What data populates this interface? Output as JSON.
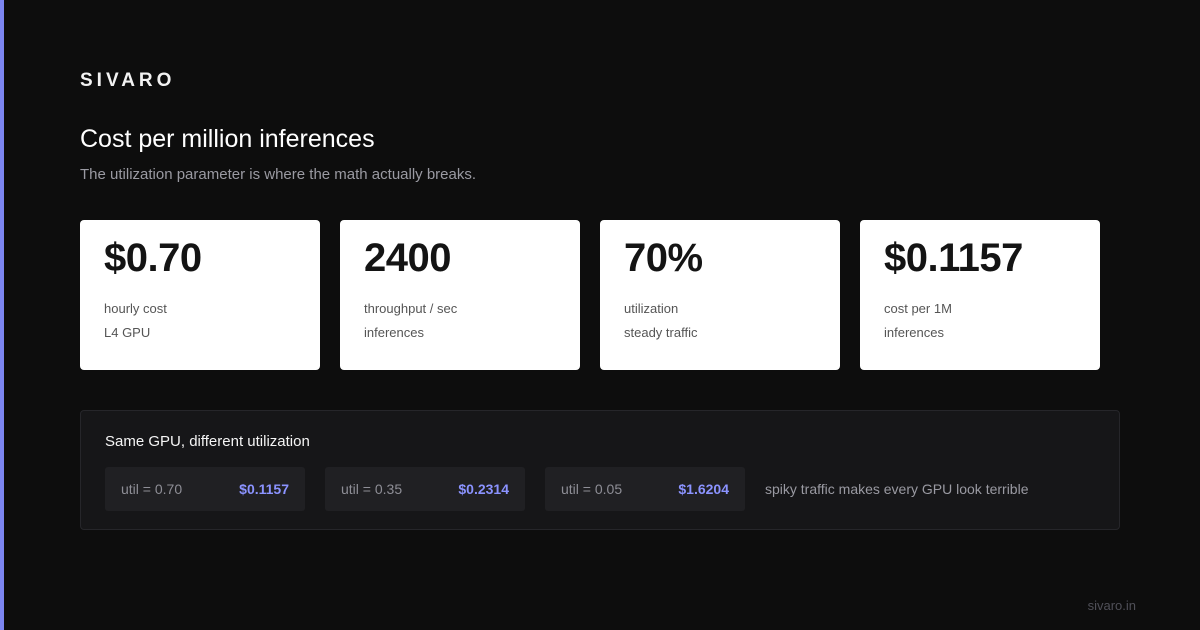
{
  "brand": "SIVARO",
  "title": "Cost per million inferences",
  "subtitle": "The utilization parameter is where the math actually breaks.",
  "accent_color": "#7c85f0",
  "highlight_color": "#8b93ff",
  "cards": [
    {
      "value": "$0.70",
      "label": "hourly cost",
      "sub": "L4 GPU"
    },
    {
      "value": "2400",
      "label": "throughput / sec",
      "sub": "inferences"
    },
    {
      "value": "70%",
      "label": "utilization",
      "sub": "steady traffic"
    },
    {
      "value": "$0.1157",
      "label": "cost per 1M",
      "sub": "inferences"
    }
  ],
  "comparison": {
    "title": "Same GPU, different utilization",
    "rows": [
      {
        "label": "util = 0.70",
        "value": "$0.1157"
      },
      {
        "label": "util = 0.35",
        "value": "$0.2314"
      },
      {
        "label": "util = 0.05",
        "value": "$1.6204"
      }
    ],
    "note": "spiky traffic makes every GPU look terrible"
  },
  "footer": "sivaro.in"
}
